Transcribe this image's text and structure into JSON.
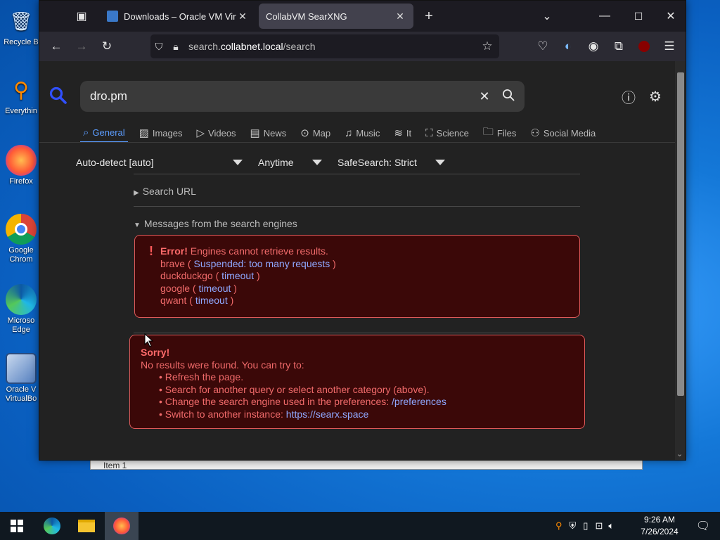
{
  "desktop": {
    "icons": [
      {
        "label": "Recycle B",
        "icon": "recycle-bin-icon"
      },
      {
        "label": "Everythin",
        "icon": "everything-search-icon"
      },
      {
        "label": "Firefox",
        "icon": "firefox-icon"
      },
      {
        "label": "Google Chrom",
        "icon": "chrome-icon"
      },
      {
        "label": "Microso Edge",
        "icon": "edge-icon"
      },
      {
        "label": "Oracle V VirtualBo",
        "icon": "virtualbox-icon"
      }
    ]
  },
  "background_window": {
    "text": "Item  1"
  },
  "browser": {
    "tabs": [
      {
        "title": "Downloads – Oracle VM VirtualB",
        "active": false
      },
      {
        "title": "CollabVM SearXNG",
        "active": true
      }
    ],
    "new_tab": "+",
    "url": {
      "host": "search.collabnet.local",
      "prefix": "search.",
      "domain": "collabnet.local",
      "path": "/search"
    }
  },
  "searx": {
    "query": "dro.pm",
    "categories": [
      {
        "label": "General",
        "icon": "search-icon",
        "active": true
      },
      {
        "label": "Images",
        "icon": "image-icon"
      },
      {
        "label": "Videos",
        "icon": "play-icon"
      },
      {
        "label": "News",
        "icon": "newspaper-icon"
      },
      {
        "label": "Map",
        "icon": "map-pin-icon"
      },
      {
        "label": "Music",
        "icon": "music-note-icon"
      },
      {
        "label": "It",
        "icon": "layers-icon"
      },
      {
        "label": "Science",
        "icon": "graduation-cap-icon"
      },
      {
        "label": "Files",
        "icon": "files-icon"
      },
      {
        "label": "Social Media",
        "icon": "users-icon"
      }
    ],
    "filters": {
      "language": "Auto-detect [auto]",
      "time": "Anytime",
      "safesearch": "SafeSearch: Strict"
    },
    "search_url_label": "Search URL",
    "engine_messages_label": "Messages from the search engines",
    "error": {
      "prefix": "!",
      "title": "Error!",
      "message": "Engines cannot retrieve results.",
      "engines": [
        {
          "name": "brave",
          "reason": "Suspended: too many requests"
        },
        {
          "name": "duckduckgo",
          "reason": "timeout"
        },
        {
          "name": "google",
          "reason": "timeout"
        },
        {
          "name": "qwant",
          "reason": "timeout"
        }
      ]
    },
    "sorry": {
      "title": "Sorry!",
      "message": "No results were found. You can try to:",
      "tips": [
        {
          "text": "Refresh the page.",
          "link": ""
        },
        {
          "text": "Search for another query or select another category (above).",
          "link": ""
        },
        {
          "text": "Change the search engine used in the preferences: ",
          "link": "/preferences"
        },
        {
          "text": "Switch to another instance: ",
          "link": "https://searx.space"
        }
      ]
    }
  },
  "taskbar": {
    "time": "9:26 AM",
    "date": "7/26/2024"
  },
  "colors": {
    "accent": "#5c9dff",
    "error_bg": "#3b0808",
    "error_border": "#e05a5a",
    "error_text": "#f06a6a",
    "link": "#8fa8ff"
  }
}
